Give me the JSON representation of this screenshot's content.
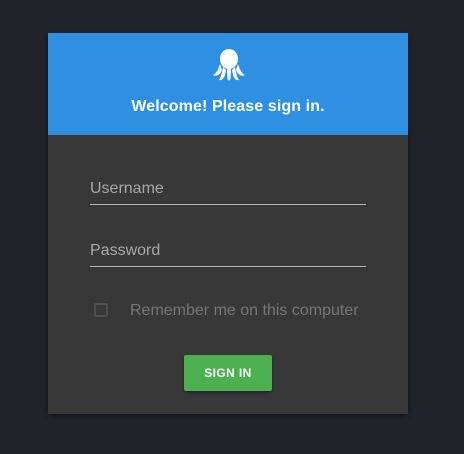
{
  "header": {
    "logo_icon": "octopus-icon",
    "title": "Welcome! Please sign in."
  },
  "form": {
    "username_placeholder": "Username",
    "username_value": "",
    "password_placeholder": "Password",
    "password_value": "",
    "remember_label": "Remember me on this computer",
    "remember_checked": false,
    "signin_label": "SIGN IN"
  },
  "colors": {
    "page_background": "#21242b",
    "card_background": "#383838",
    "header_background": "#2f8fe1",
    "signin_button": "#4caf50"
  }
}
